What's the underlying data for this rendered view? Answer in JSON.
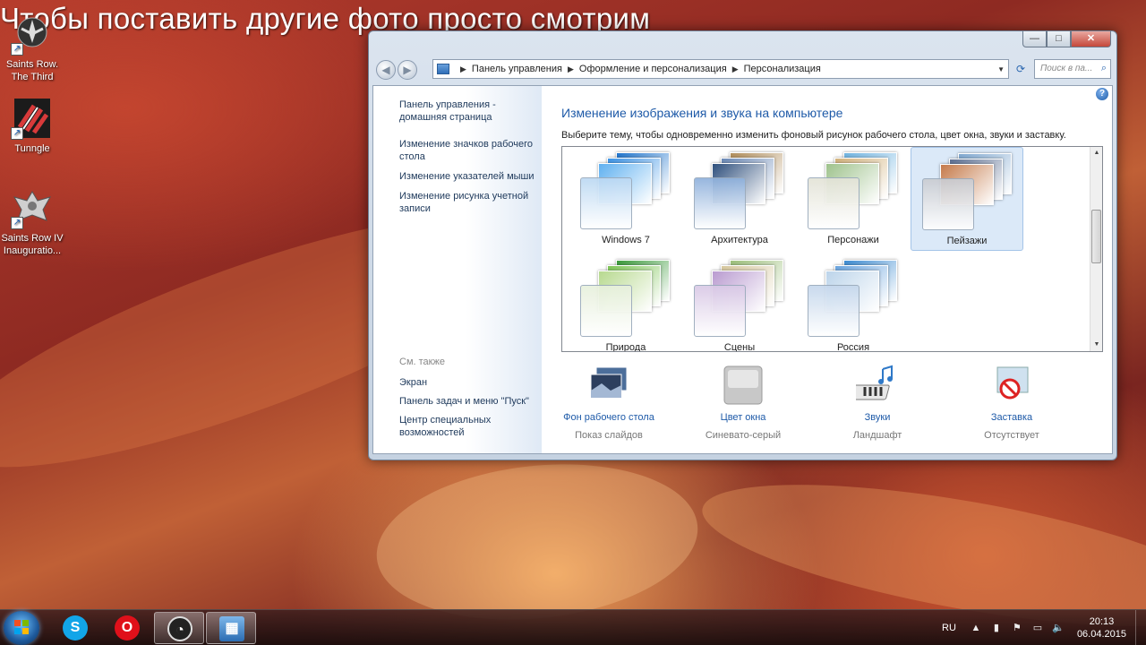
{
  "caption": "Чтобы поставить другие фото просто смотрим",
  "desktop_icons": [
    {
      "label": "Saints Row. The Third",
      "icon": "saints-row-fleur-icon"
    },
    {
      "label": "Tunngle",
      "icon": "tunngle-icon"
    },
    {
      "label": "Saints Row IV Inauguratio...",
      "icon": "saints-row-eagle-icon"
    }
  ],
  "window": {
    "controls": {
      "minimize": "—",
      "maximize": "□",
      "close": "✕"
    },
    "nav": {
      "back": "◀",
      "forward": "▶"
    },
    "breadcrumb": [
      "Панель управления",
      "Оформление и персонализация",
      "Персонализация"
    ],
    "search_placeholder": "Поиск в па...",
    "sidebar": {
      "links": [
        "Панель управления - домашняя страница",
        "Изменение значков рабочего стола",
        "Изменение указателей мыши",
        "Изменение рисунка учетной записи"
      ],
      "see_also_heading": "См. также",
      "see_also": [
        "Экран",
        "Панель задач и меню \"Пуск\"",
        "Центр специальных возможностей"
      ]
    },
    "help": "?",
    "title": "Изменение изображения и звука на компьютере",
    "subtitle": "Выберите тему, чтобы одновременно изменить фоновый рисунок рабочего стола, цвет окна, звуки и заставку.",
    "themes": [
      {
        "name": "Windows 7",
        "selected": false,
        "colors": [
          "#1f74cc",
          "#3c93e5",
          "#5fb0f0"
        ],
        "swatch": "#bcd9f3"
      },
      {
        "name": "Архитектура",
        "selected": false,
        "colors": [
          "#b08d5b",
          "#6a88b5",
          "#2e4f7c"
        ],
        "swatch": "#8fb1dc"
      },
      {
        "name": "Персонажи",
        "selected": false,
        "colors": [
          "#6fb3e0",
          "#d2b27c",
          "#9ec28c"
        ],
        "swatch": "#e3e3d7"
      },
      {
        "name": "Пейзажи",
        "selected": true,
        "colors": [
          "#7fa7cf",
          "#5c6f92",
          "#c57a4a"
        ],
        "swatch": "#c9ccd2"
      },
      {
        "name": "Природа",
        "selected": false,
        "colors": [
          "#3a9a3a",
          "#7ec456",
          "#b7d98f"
        ],
        "swatch": "#e7f0dc"
      },
      {
        "name": "Сцены",
        "selected": false,
        "colors": [
          "#9cbf7a",
          "#d6c79e",
          "#b99bd0"
        ],
        "swatch": "#d9c9e6"
      },
      {
        "name": "Россия",
        "selected": false,
        "colors": [
          "#3c8bd1",
          "#6aa4de",
          "#bcd4ea"
        ],
        "swatch": "#c5d7ec"
      }
    ],
    "bottom_items": [
      {
        "label": "Фон рабочего стола",
        "value": "Показ слайдов",
        "icon": "desktop-background-icon"
      },
      {
        "label": "Цвет окна",
        "value": "Синевато-серый",
        "icon": "window-color-icon"
      },
      {
        "label": "Звуки",
        "value": "Ландшафт",
        "icon": "sounds-icon"
      },
      {
        "label": "Заставка",
        "value": "Отсутствует",
        "icon": "screensaver-icon"
      }
    ]
  },
  "taskbar": {
    "apps": [
      "skype-icon",
      "opera-icon",
      "obs-icon",
      "control-panel-icon"
    ],
    "lang": "RU",
    "time": "20:13",
    "date": "06.04.2015"
  }
}
